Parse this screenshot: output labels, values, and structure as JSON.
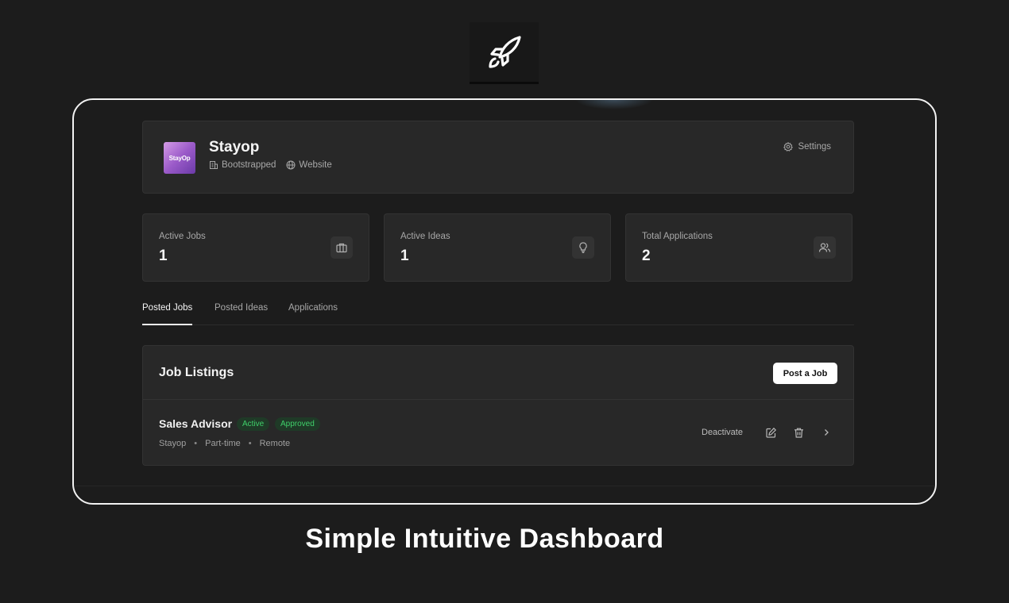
{
  "company": {
    "logo_text": "StayOp",
    "name": "Stayop",
    "funding": "Bootstrapped",
    "website_label": "Website",
    "settings_label": "Settings"
  },
  "stats": [
    {
      "label": "Active Jobs",
      "value": "1",
      "icon": "briefcase-icon"
    },
    {
      "label": "Active Ideas",
      "value": "1",
      "icon": "lightbulb-icon"
    },
    {
      "label": "Total Applications",
      "value": "2",
      "icon": "users-icon"
    }
  ],
  "tabs": [
    {
      "label": "Posted Jobs",
      "active": true
    },
    {
      "label": "Posted Ideas",
      "active": false
    },
    {
      "label": "Applications",
      "active": false
    }
  ],
  "job_listings": {
    "title": "Job Listings",
    "post_button": "Post a Job",
    "jobs": [
      {
        "title": "Sales Advisor",
        "status": "Active",
        "approval": "Approved",
        "company": "Stayop",
        "type": "Part-time",
        "location": "Remote",
        "deactivate_label": "Deactivate"
      }
    ]
  },
  "caption": "Simple Intuitive Dashboard",
  "colors": {
    "background": "#1c1c1c",
    "card": "#282828",
    "badge_green": "#3fcf6a"
  }
}
